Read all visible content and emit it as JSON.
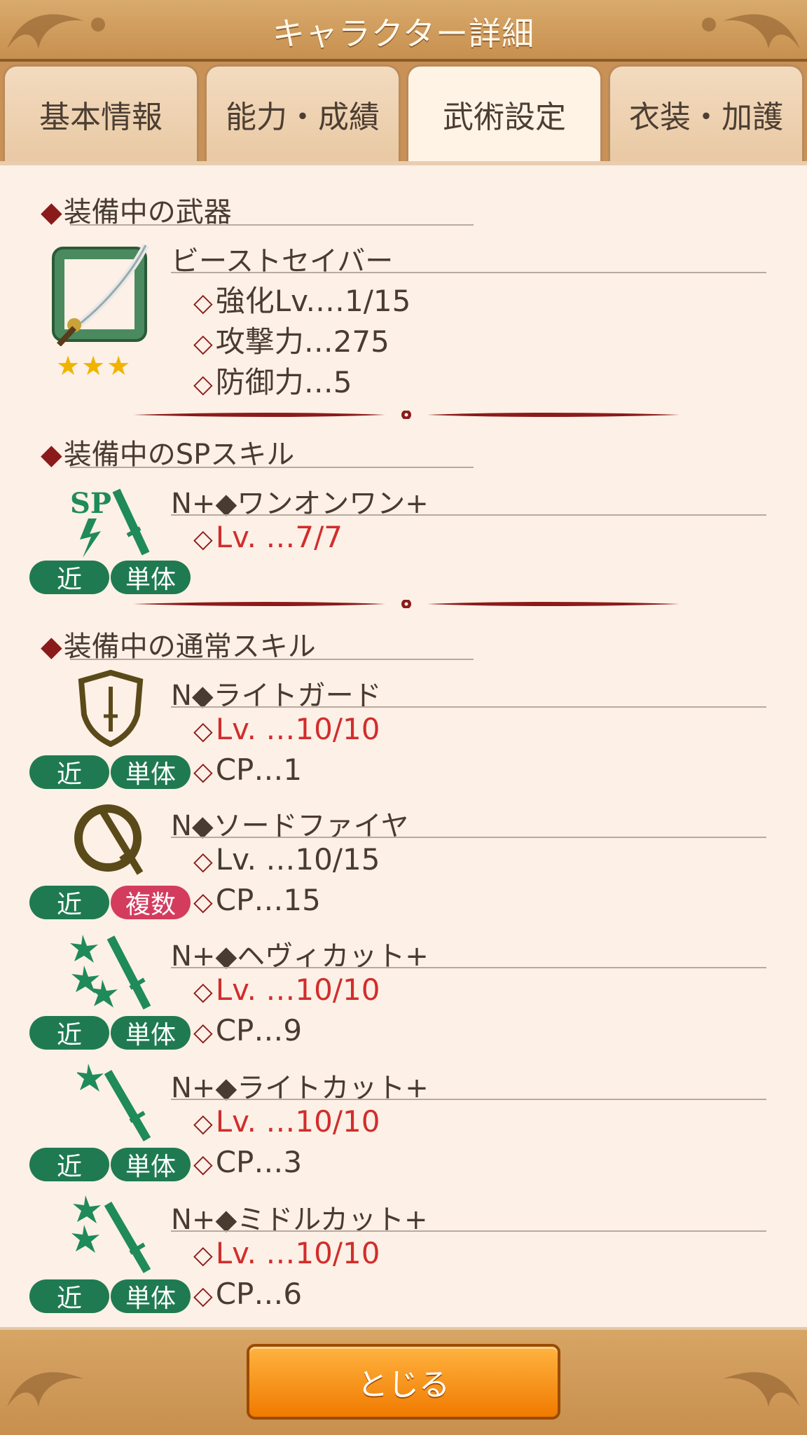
{
  "header": {
    "title": "キャラクター詳細"
  },
  "tabs": [
    {
      "label": "基本情報"
    },
    {
      "label": "能力・成績"
    },
    {
      "label": "武術設定"
    },
    {
      "label": "衣装・加護"
    }
  ],
  "weapon_section": {
    "title": "装備中の武器",
    "name": "ビーストセイバー",
    "stars": "★★★",
    "stats": [
      "強化Lv.…1/15",
      "攻撃力…275",
      "防御力…5"
    ]
  },
  "sp_section": {
    "title": "装備中のSPスキル",
    "skill": {
      "name": "N+◆ワンオンワン+",
      "level": "Lv. …7/7",
      "range": "近",
      "target": "単体"
    }
  },
  "normal_section": {
    "title": "装備中の通常スキル",
    "skills": [
      {
        "name": "N◆ライトガード",
        "level": "Lv. …10/10",
        "cp": "CP…1",
        "range": "近",
        "target": "単体"
      },
      {
        "name": "N◆ソードファイヤ",
        "level": "Lv. …10/15",
        "cp": "CP…15",
        "range": "近",
        "target": "複数"
      },
      {
        "name": "N+◆ヘヴィカット+",
        "level": "Lv. …10/10",
        "cp": "CP…9",
        "range": "近",
        "target": "単体"
      },
      {
        "name": "N+◆ライトカット+",
        "level": "Lv. …10/10",
        "cp": "CP…3",
        "range": "近",
        "target": "単体"
      },
      {
        "name": "N+◆ミドルカット+",
        "level": "Lv. …10/10",
        "cp": "CP…6",
        "range": "近",
        "target": "単体"
      }
    ]
  },
  "footer": {
    "close_label": "とじる"
  },
  "colors": {
    "accent_red": "#d12d2d",
    "badge_green": "#1f7a52",
    "badge_pink": "#d43c5e",
    "button_orange": "#f07a00"
  }
}
